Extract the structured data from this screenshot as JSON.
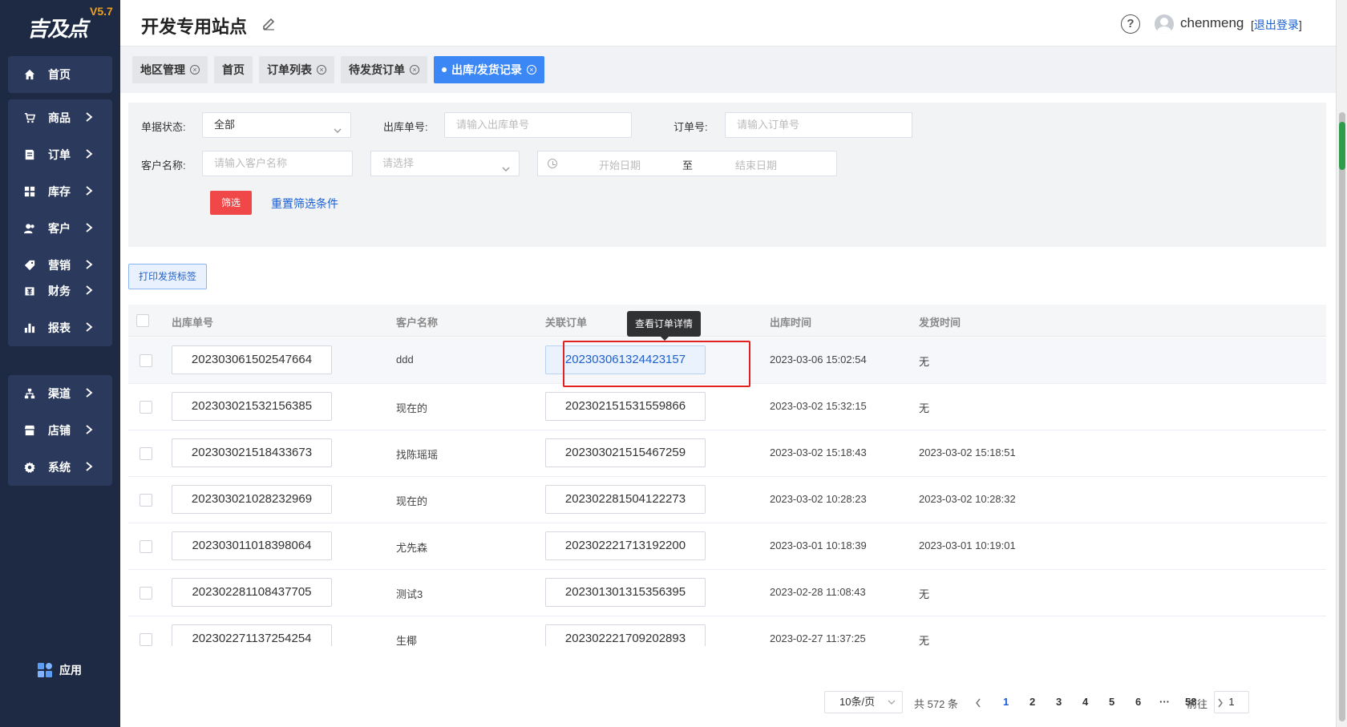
{
  "sidebar": {
    "logo_text": "吉及点",
    "version": "V5.7",
    "groups": [
      [
        {
          "label": "首页",
          "icon": "home-icon"
        }
      ],
      [
        {
          "label": "商品",
          "icon": "cart-icon"
        },
        {
          "label": "订单",
          "icon": "order-icon"
        },
        {
          "label": "库存",
          "icon": "inventory-icon"
        },
        {
          "label": "客户",
          "icon": "customer-icon"
        },
        {
          "label": "营销",
          "icon": "tag-icon"
        }
      ],
      [
        {
          "label": "财务",
          "icon": "finance-icon"
        },
        {
          "label": "报表",
          "icon": "chart-icon"
        }
      ],
      [
        {
          "label": "渠道",
          "icon": "channel-icon"
        },
        {
          "label": "店铺",
          "icon": "store-icon"
        },
        {
          "label": "系统",
          "icon": "gear-icon"
        }
      ]
    ],
    "app_label": "应用"
  },
  "header": {
    "title": "开发专用站点",
    "username": "chenmeng",
    "logout_label": "退出登录"
  },
  "tabs": [
    {
      "label": "地区管理",
      "closable": true
    },
    {
      "label": "首页",
      "closable": false
    },
    {
      "label": "订单列表",
      "closable": true
    },
    {
      "label": "待发货订单",
      "closable": true
    },
    {
      "label": "出库/发货记录",
      "closable": true,
      "active": true
    }
  ],
  "filter": {
    "status_label": "单据状态:",
    "status_value": "全部",
    "outbound_no_label": "出库单号:",
    "outbound_no_placeholder": "请输入出库单号",
    "order_no_label": "订单号:",
    "order_no_placeholder": "请输入订单号",
    "customer_label": "客户名称:",
    "customer_placeholder": "请输入客户名称",
    "select_placeholder": "请选择",
    "start_date_placeholder": "开始日期",
    "range_separator": "至",
    "end_date_placeholder": "结束日期",
    "filter_button": "筛选",
    "reset_button": "重置筛选条件"
  },
  "print_button": "打印发货标签",
  "table": {
    "columns": [
      "出库单号",
      "客户名称",
      "关联订单",
      "出库时间",
      "发货时间"
    ],
    "tooltip": "查看订单详情",
    "rows": [
      {
        "outbound_no": "202303061502547664",
        "customer": "ddd",
        "order_no": "202303061324423157",
        "out_time": "2023-03-06 15:02:54",
        "ship_time": "无"
      },
      {
        "outbound_no": "202303021532156385",
        "customer": "现在的",
        "order_no": "202302151531559866",
        "out_time": "2023-03-02 15:32:15",
        "ship_time": "无"
      },
      {
        "outbound_no": "202303021518433673",
        "customer": "找陈瑶瑶",
        "order_no": "202303021515467259",
        "out_time": "2023-03-02 15:18:43",
        "ship_time": "2023-03-02 15:18:51"
      },
      {
        "outbound_no": "202303021028232969",
        "customer": "现在的",
        "order_no": "202302281504122273",
        "out_time": "2023-03-02 10:28:23",
        "ship_time": "2023-03-02 10:28:32"
      },
      {
        "outbound_no": "202303011018398064",
        "customer": "尤先森",
        "order_no": "202302221713192200",
        "out_time": "2023-03-01 10:18:39",
        "ship_time": "2023-03-01 10:19:01"
      },
      {
        "outbound_no": "202302281108437705",
        "customer": "测试3",
        "order_no": "202301301315356395",
        "out_time": "2023-02-28 11:08:43",
        "ship_time": "无"
      },
      {
        "outbound_no": "202302271137254254",
        "customer": "生椰",
        "order_no": "202302221709202893",
        "out_time": "2023-02-27 11:37:25",
        "ship_time": "无"
      }
    ]
  },
  "pagination": {
    "page_size": "10条/页",
    "total": "共 572 条",
    "pages": [
      "1",
      "2",
      "3",
      "4",
      "5",
      "6",
      "···",
      "58"
    ],
    "current": "1",
    "goto_label": "前往",
    "goto_value": "1"
  },
  "colors": {
    "sidebar_bg": "#1e2a44",
    "active_tab": "#3b87f5",
    "filter_button": "#f04848",
    "link": "#1a5fd1",
    "highlight_border": "#e02222"
  }
}
